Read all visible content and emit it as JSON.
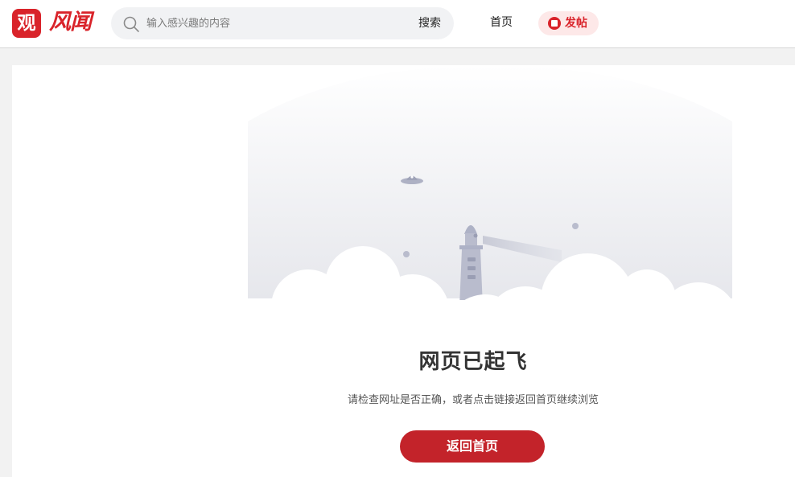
{
  "header": {
    "logo_mark": "观",
    "logo_text": "风闻",
    "search": {
      "placeholder": "输入感兴趣的内容",
      "button_label": "搜索"
    },
    "nav_home": "首页",
    "post_button": "发帖"
  },
  "error_page": {
    "title": "网页已起飞",
    "description": "请检查网址是否正确，或者点击链接返回首页继续浏览",
    "home_button": "返回首页"
  },
  "colors": {
    "brand": "#d9232a",
    "button": "#c3232a",
    "page_bg": "#f2f2f2"
  },
  "icons": [
    "search-icon",
    "post-icon",
    "lighthouse-icon",
    "ufo-icon",
    "cloud-icon"
  ]
}
